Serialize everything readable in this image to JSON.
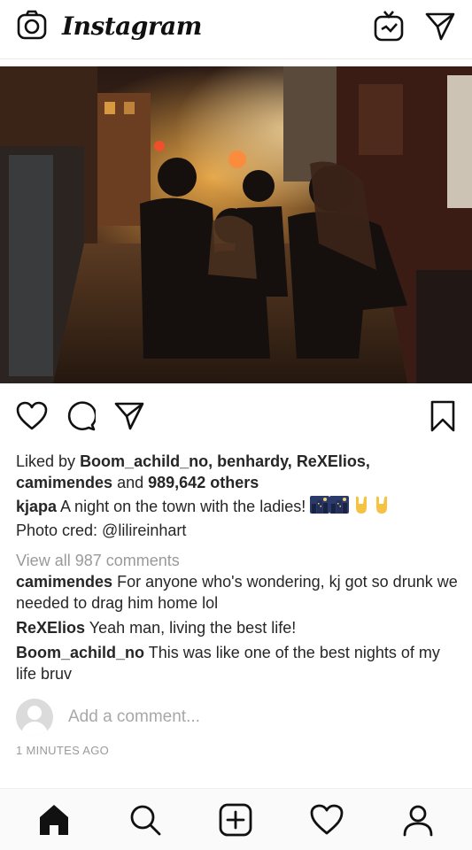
{
  "app": {
    "logo_text": "Instagram"
  },
  "header": {
    "icons": [
      "camera-icon",
      "igtv-icon",
      "direct-message-icon"
    ]
  },
  "post": {
    "photo_alt": "",
    "actions": {
      "icons": [
        "heart-icon",
        "comment-icon",
        "share-icon",
        "bookmark-icon"
      ]
    },
    "likes": {
      "prefix": "Liked by",
      "users": [
        "Boom_achild_no,",
        "benhardy,",
        "ReXElios,",
        "camimendes"
      ],
      "conjunction": "and",
      "count": "989,642 others"
    },
    "caption": {
      "username": "kjapa",
      "text": "A night on the town with the ladies!",
      "emojis": [
        "night-city-emoji",
        "night-city-emoji",
        "rock-hand-emoji",
        "rock-hand-emoji"
      ],
      "second_line": "Photo cred: @lilireinhart"
    },
    "view_all_comments": "View all 987 comments",
    "comments": [
      {
        "username": "camimendes",
        "text": "For anyone who's wondering, kj got so drunk we needed to drag him home lol"
      },
      {
        "username": "ReXElios",
        "text": "Yeah man, living the best life!"
      },
      {
        "username": "Boom_achild_no",
        "text": "This was like one of the best nights of my life bruv"
      }
    ],
    "add_comment_placeholder": "Add a comment...",
    "timestamp": "1 MINUTES AGO"
  },
  "bottom_nav": {
    "items": [
      "home-icon",
      "search-icon",
      "new-post-icon",
      "activity-heart-icon",
      "profile-icon"
    ]
  }
}
